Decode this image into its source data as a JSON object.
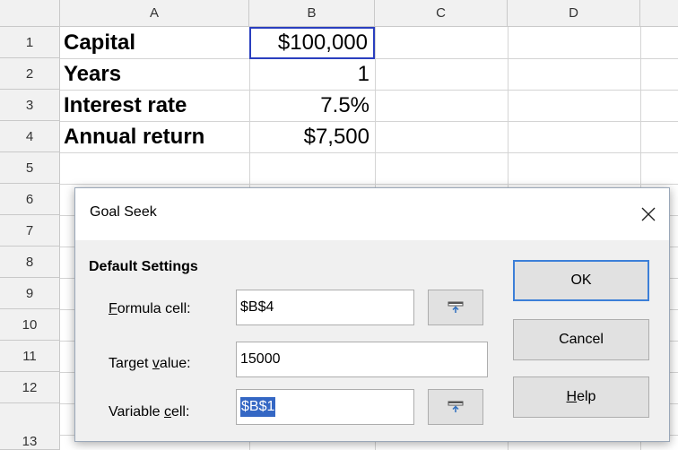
{
  "sheet": {
    "columns": [
      "A",
      "B",
      "C",
      "D"
    ],
    "rows": [
      "1",
      "2",
      "3",
      "4",
      "5",
      "6",
      "7",
      "8",
      "9",
      "10",
      "11",
      "12",
      "13"
    ],
    "cells": [
      {
        "label": "Capital",
        "value": "$100,000"
      },
      {
        "label": "Years",
        "value": "1"
      },
      {
        "label": "Interest rate",
        "value": "7.5%"
      },
      {
        "label": "Annual return",
        "value": "$7,500"
      }
    ],
    "selected_cell": "B1"
  },
  "dialog": {
    "title": "Goal Seek",
    "close_icon": "close-icon",
    "section_title": "Default Settings",
    "formula_label_mnemonic": "F",
    "formula_label_rest": "ormula cell:",
    "formula_value": "$B$4",
    "target_label_pre": "Target ",
    "target_label_mnemonic": "v",
    "target_label_rest": "alue:",
    "target_value": "15000",
    "variable_label_pre": "Variable ",
    "variable_label_mnemonic": "c",
    "variable_label_rest": "ell:",
    "variable_value": "$B$1",
    "shrink_icon": "shrink-range-icon",
    "ok_label": "OK",
    "cancel_label": "Cancel",
    "help_mnemonic": "H",
    "help_rest": "elp"
  },
  "colors": {
    "selection_border": "#2a3fbf",
    "text_selection": "#3467c4",
    "default_button_border": "#3c7fd8"
  }
}
